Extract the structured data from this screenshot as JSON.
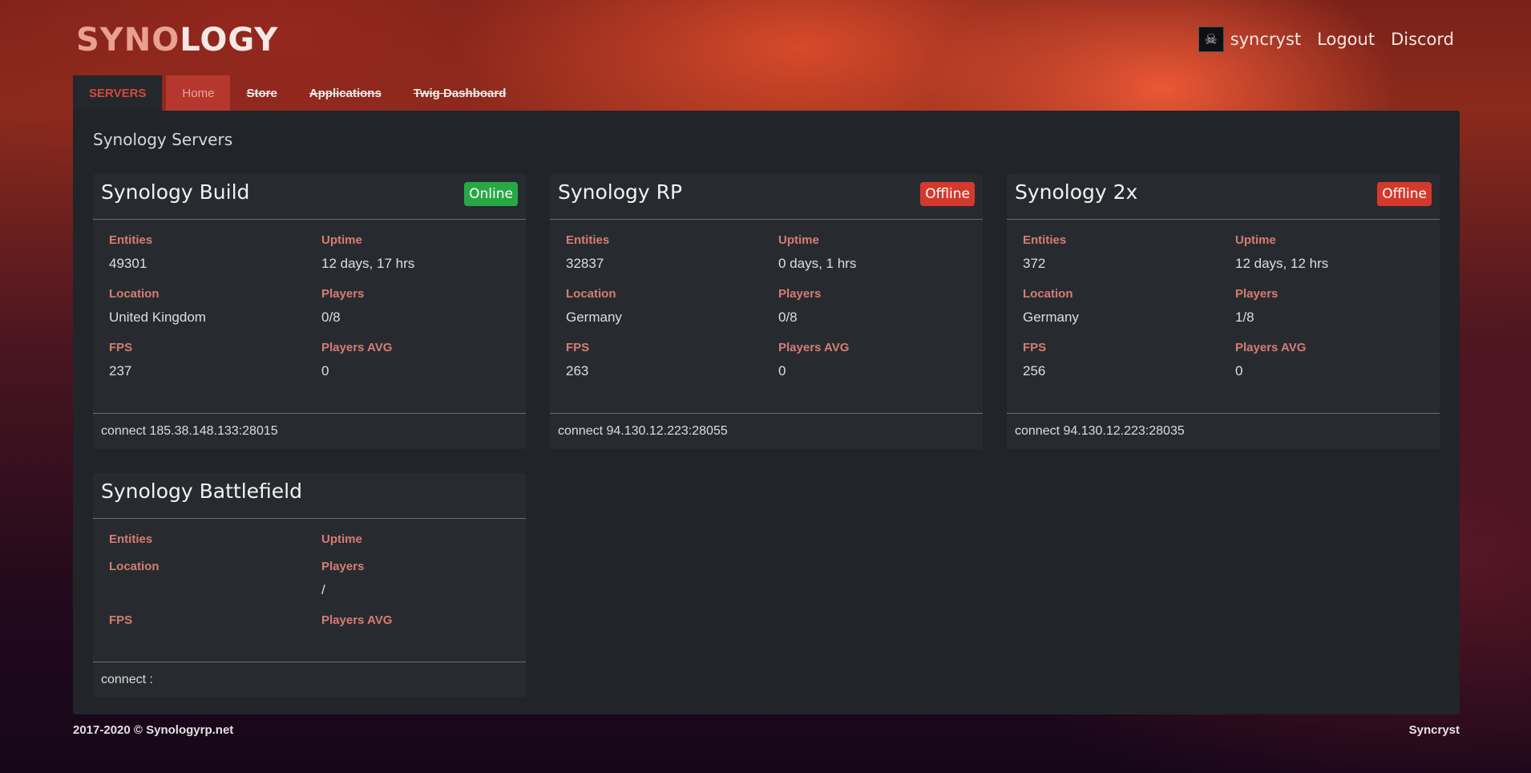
{
  "brand": {
    "part1": "SYNO",
    "part2": "LOGY"
  },
  "user": {
    "name": "syncryst",
    "avatar_icon": "skull-avatar-icon"
  },
  "topnav": {
    "logout": "Logout",
    "discord": "Discord"
  },
  "tabs": [
    {
      "label": "SERVERS",
      "state": "active"
    },
    {
      "label": "Home",
      "state": "highlight"
    },
    {
      "label": "Store",
      "state": "strike"
    },
    {
      "label": "Applications",
      "state": "strike"
    },
    {
      "label": "Twig Dashboard",
      "state": "strike"
    }
  ],
  "page_title": "Synology Servers",
  "labels": {
    "entities": "Entities",
    "uptime": "Uptime",
    "location": "Location",
    "players": "Players",
    "fps": "FPS",
    "players_avg": "Players AVG"
  },
  "servers": [
    {
      "name": "Synology Build",
      "status": "Online",
      "entities": "49301",
      "uptime": "12 days, 17 hrs",
      "location": "United Kingdom",
      "players": "0/8",
      "fps": "237",
      "players_avg": "0",
      "connect": "connect 185.38.148.133:28015"
    },
    {
      "name": "Synology RP",
      "status": "Offline",
      "entities": "32837",
      "uptime": "0 days, 1 hrs",
      "location": "Germany",
      "players": "0/8",
      "fps": "263",
      "players_avg": "0",
      "connect": "connect 94.130.12.223:28055"
    },
    {
      "name": "Synology 2x",
      "status": "Offline",
      "entities": "372",
      "uptime": "12 days, 12 hrs",
      "location": "Germany",
      "players": "1/8",
      "fps": "256",
      "players_avg": "0",
      "connect": "connect 94.130.12.223:28035"
    },
    {
      "name": "Synology Battlefield",
      "status": "",
      "entities": "",
      "uptime": "",
      "location": "",
      "players": "/",
      "fps": "",
      "players_avg": "",
      "connect": "connect :"
    }
  ],
  "colors": {
    "online": "#27a844",
    "offline": "#d33a2c",
    "accent": "#d9473d"
  },
  "footer": {
    "copyright": "2017-2020 © Synologyrp.net",
    "author": "Syncryst"
  }
}
